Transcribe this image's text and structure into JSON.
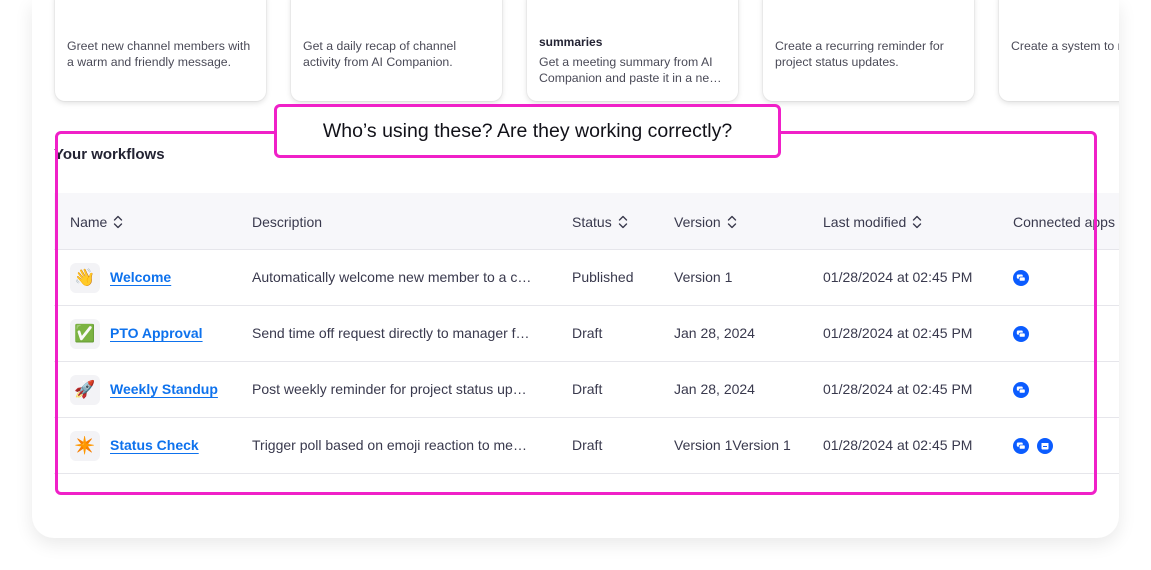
{
  "templates": [
    {
      "title": "",
      "description": "Greet new channel members with a warm and friendly message."
    },
    {
      "title": "",
      "description": "Get a daily recap of channel activity from AI Companion."
    },
    {
      "title": "summaries",
      "description": "Get a meeting summary from AI Companion and paste it in a ne…"
    },
    {
      "title": "",
      "description": "Create a recurring reminder for project status updates."
    },
    {
      "title": "",
      "description": "Create a system to manage team reque"
    }
  ],
  "section_title": "Your workflows",
  "table": {
    "columns": [
      "Name",
      "Description",
      "Status",
      "Version",
      "Last modified",
      "Connected apps"
    ],
    "rows": [
      {
        "emoji": "👋",
        "emoji_name": "waving-hand-icon",
        "name": "Welcome",
        "description": "Automatically welcome new member to a c…",
        "status": "Published",
        "version": "Version 1",
        "modified": "01/28/2024 at 02:45 PM",
        "apps": [
          "chat-app-icon"
        ]
      },
      {
        "emoji": "✅",
        "emoji_name": "check-mark-icon",
        "name": "PTO Approval",
        "description": "Send time off request directly to manager f…",
        "status": "Draft",
        "version": "Jan 28, 2024",
        "modified": "01/28/2024 at 02:45 PM",
        "apps": [
          "chat-app-icon"
        ]
      },
      {
        "emoji": "🚀",
        "emoji_name": "rocket-icon",
        "name": "Weekly Standup",
        "description": "Post weekly reminder for project status up…",
        "status": "Draft",
        "version": "Jan 28, 2024",
        "modified": "01/28/2024 at 02:45 PM",
        "apps": [
          "chat-app-icon"
        ]
      },
      {
        "emoji": "✴️",
        "emoji_name": "eight-pointed-star-icon",
        "name": "Status Check",
        "description": "Trigger poll based on emoji reaction to me…",
        "status": "Draft",
        "version": "Version 1Version 1",
        "modified": "01/28/2024 at 02:45 PM",
        "apps": [
          "chat-app-icon",
          "calendar-app-icon"
        ]
      }
    ]
  },
  "annotation": {
    "text": "Who’s using these? Are they working correctly?",
    "color": "#f020c8"
  },
  "colors": {
    "link": "#0e72ed",
    "app_icon": "#0b5cff"
  }
}
